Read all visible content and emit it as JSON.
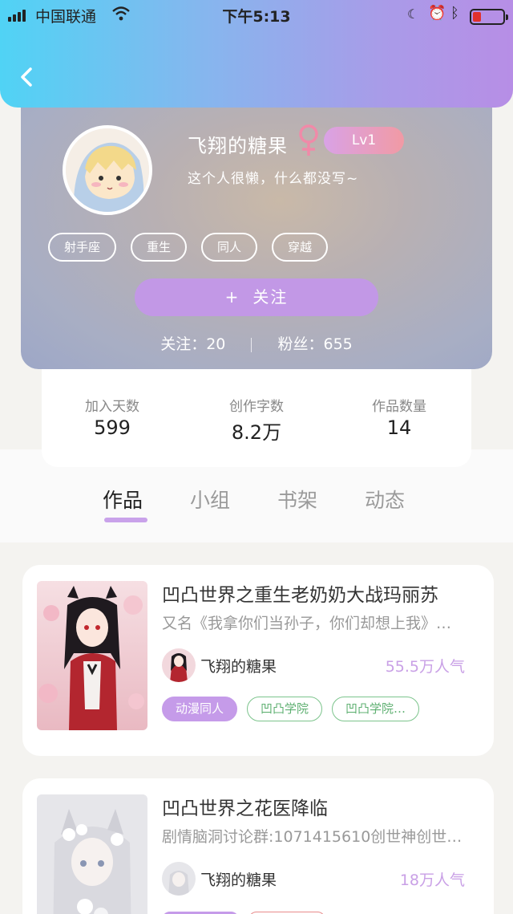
{
  "status_bar": {
    "carrier": "中国联通",
    "time": "下午5:13"
  },
  "profile": {
    "username": "飞翔的糖果",
    "gender_symbol": "♀",
    "level": "Lv1",
    "bio": "这个人很懒，什么都没写~",
    "tags": [
      "射手座",
      "重生",
      "同人",
      "穿越"
    ],
    "follow_button": "关注",
    "follow_plus": "+",
    "following_label": "关注：20",
    "fans_label": "粉丝：655"
  },
  "stats": [
    {
      "label": "加入天数",
      "value": "599"
    },
    {
      "label": "创作字数",
      "value": "8.2万"
    },
    {
      "label": "作品数量",
      "value": "14"
    }
  ],
  "tabs": [
    "作品",
    "小组",
    "书架",
    "动态"
  ],
  "active_tab": "作品",
  "works": [
    {
      "title": "凹凸世界之重生老奶奶大战玛丽苏",
      "subtitle": "又名《我拿你们当孙子，你们却想上我》…",
      "author": "飞翔的糖果",
      "popularity": "55.5万人气",
      "tags": [
        "动漫同人",
        "凹凸学院",
        "凹凸学院…"
      ]
    },
    {
      "title": "凹凸世界之花医降临",
      "subtitle": "剧情脑洞讨论群:1071415610创世神创世…",
      "author": "飞翔的糖果",
      "popularity": "18万人气",
      "tags": []
    }
  ],
  "colors": {
    "accent_purple": "#c298e6",
    "tag_green": "#7cc48c",
    "level_gradient_start": "#d9a2e6",
    "level_gradient_end": "#f19aa4"
  }
}
